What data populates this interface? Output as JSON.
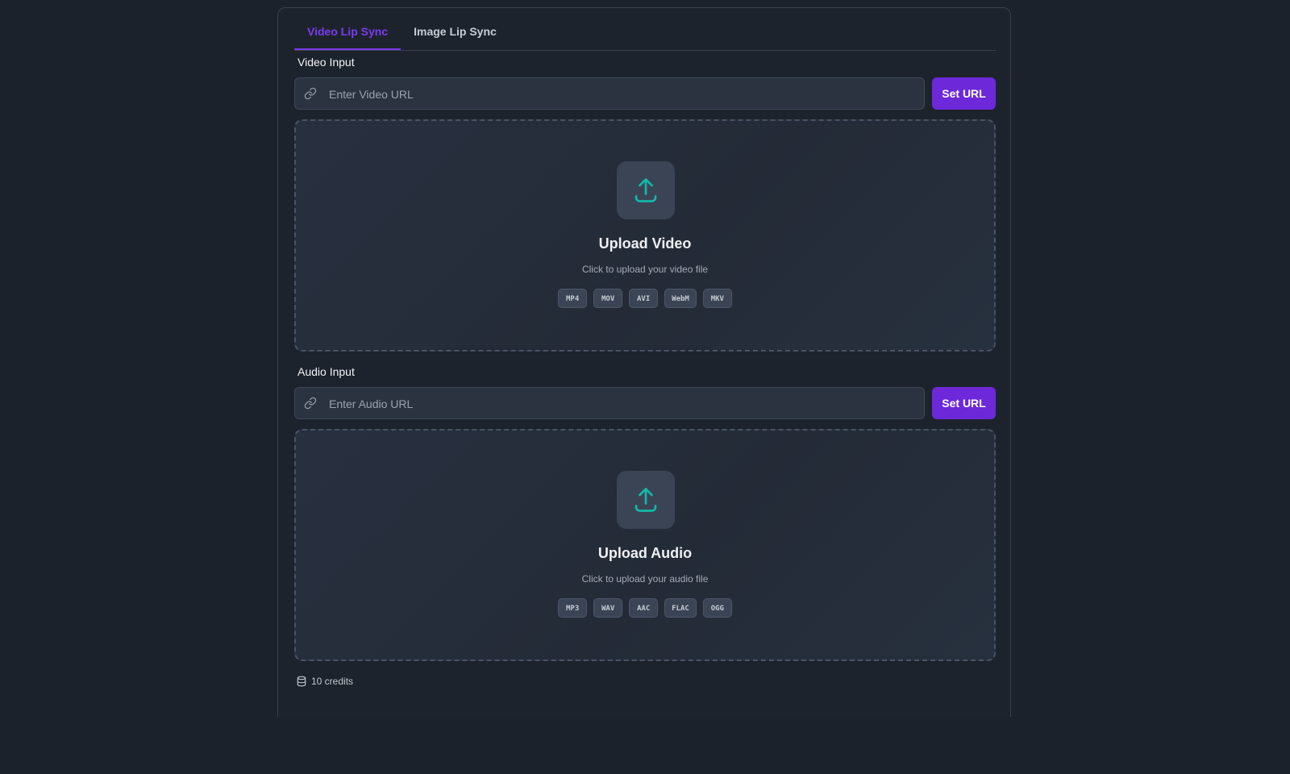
{
  "tabs": [
    {
      "label": "Video Lip Sync",
      "active": true
    },
    {
      "label": "Image Lip Sync",
      "active": false
    }
  ],
  "video": {
    "section_label": "Video Input",
    "url_placeholder": "Enter Video URL",
    "url_value": "",
    "set_url_label": "Set URL",
    "upload_title": "Upload Video",
    "upload_subtitle": "Click to upload your video file",
    "formats": [
      "MP4",
      "MOV",
      "AVI",
      "WebM",
      "MKV"
    ]
  },
  "audio": {
    "section_label": "Audio Input",
    "url_placeholder": "Enter Audio URL",
    "url_value": "",
    "set_url_label": "Set URL",
    "upload_title": "Upload Audio",
    "upload_subtitle": "Click to upload your audio file",
    "formats": [
      "MP3",
      "WAV",
      "AAC",
      "FLAC",
      "OGG"
    ]
  },
  "credits": {
    "label": "10 credits",
    "icon": "coins-icon"
  },
  "colors": {
    "accent": "#6d28d9",
    "tab_active": "#7c3aed",
    "upload_icon": "#14b8a6",
    "background": "#1c222b"
  },
  "icons": {
    "url": "link-icon",
    "upload": "upload-icon"
  }
}
